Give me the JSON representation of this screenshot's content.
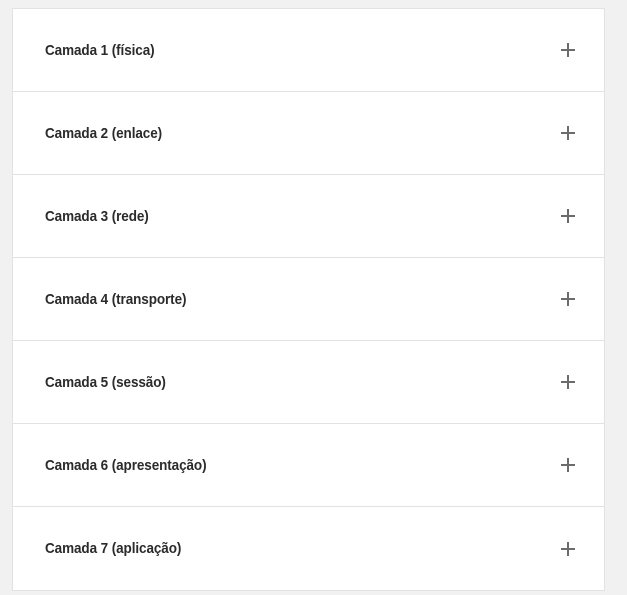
{
  "accordion": {
    "items": [
      {
        "label": "Camada 1 (física)",
        "icon": "plus-icon"
      },
      {
        "label": "Camada 2 (enlace)",
        "icon": "plus-icon"
      },
      {
        "label": "Camada 3 (rede)",
        "icon": "plus-icon"
      },
      {
        "label": "Camada 4 (transporte)",
        "icon": "plus-icon"
      },
      {
        "label": "Camada 5 (sessão)",
        "icon": "plus-icon"
      },
      {
        "label": "Camada 6 (apresentação)",
        "icon": "plus-icon"
      },
      {
        "label": "Camada 7 (aplicação)",
        "icon": "plus-icon"
      }
    ]
  }
}
